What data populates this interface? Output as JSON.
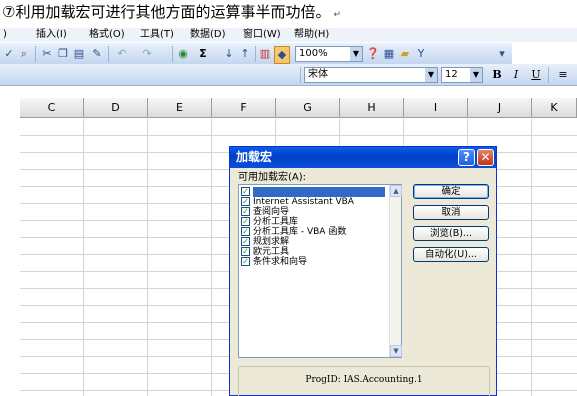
{
  "caption": {
    "text": "⑦利用加载宏可进行其他方面的运算事半而功倍。",
    "mark": "↵"
  },
  "menubar": [
    "插入(I)",
    "格式(O)",
    "工具(T)",
    "数据(D)",
    "窗口(W)",
    "帮助(H)"
  ],
  "menubar_left_fragment": ")",
  "toolbar": {
    "zoom": "100%",
    "font": "宋体",
    "font_size": "12",
    "sigma": "Σ",
    "bold": "B",
    "italic": "I",
    "underline": "U"
  },
  "columns": [
    "C",
    "D",
    "E",
    "F",
    "G",
    "H",
    "I",
    "J",
    "K"
  ],
  "dialog": {
    "title": "加载宏",
    "help": "?",
    "close": "✕",
    "list_label": "可用加载宏(A):",
    "items": [
      {
        "label": "",
        "checked": true,
        "selected": true
      },
      {
        "label": "Internet Assistant VBA",
        "checked": true
      },
      {
        "label": "查阅向导",
        "checked": true
      },
      {
        "label": "分析工具库",
        "checked": true
      },
      {
        "label": "分析工具库 - VBA 函数",
        "checked": true
      },
      {
        "label": "规划求解",
        "checked": true
      },
      {
        "label": "欧元工具",
        "checked": true
      },
      {
        "label": "条件求和向导",
        "checked": true
      }
    ],
    "buttons": {
      "ok": "确定",
      "cancel": "取消",
      "browse": "浏览(B)...",
      "automation": "自动化(U)..."
    },
    "progid": "ProgID: IAS.Accounting.1"
  }
}
